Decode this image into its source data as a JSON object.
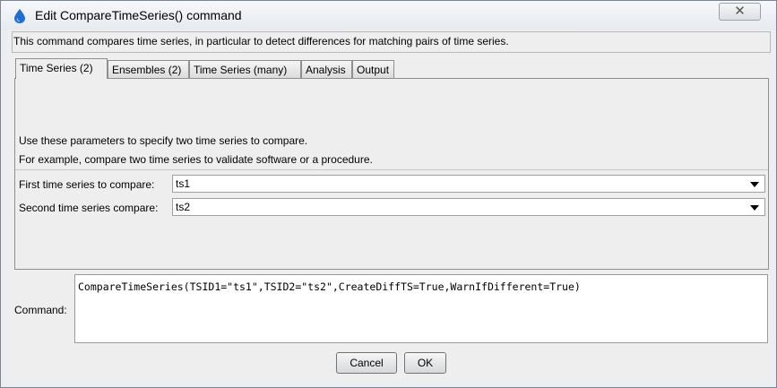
{
  "window": {
    "title": "Edit CompareTimeSeries() command",
    "close_symbol": "✕"
  },
  "description": "This command compares time series, in particular to detect differences for matching pairs of time series.",
  "tabs": [
    {
      "label": "Time Series (2)",
      "active": true
    },
    {
      "label": "Ensembles (2)",
      "active": false
    },
    {
      "label": "Time Series (many)",
      "active": false
    },
    {
      "label": "Analysis",
      "active": false
    },
    {
      "label": "Output",
      "active": false
    }
  ],
  "panel": {
    "line1": "Use these parameters to specify two time series to compare.",
    "line2": "For example, compare two time series to validate software or a procedure.",
    "fields": [
      {
        "label": "First time series to compare:",
        "value": "ts1"
      },
      {
        "label": "Second time series compare:",
        "value": "ts2"
      }
    ]
  },
  "command": {
    "label": "Command:",
    "text": "CompareTimeSeries(TSID1=\"ts1\",TSID2=\"ts2\",CreateDiffTS=True,WarnIfDifferent=True)"
  },
  "buttons": {
    "cancel": "Cancel",
    "ok": "OK"
  },
  "icons": {
    "app": "water-drop-icon",
    "close": "close-icon",
    "dropdown": "chevron-down-icon"
  },
  "colors": {
    "drop_icon": "#1e6fd0"
  }
}
